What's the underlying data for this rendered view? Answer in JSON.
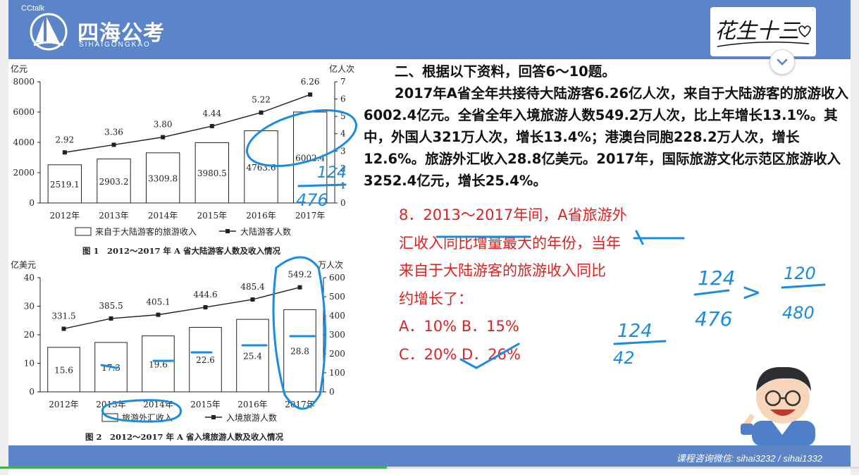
{
  "app": {
    "name": "CCtalk"
  },
  "brand": {
    "title": "四海公考",
    "subtitle": "SIHAIGONGKAO"
  },
  "signature": "花生十三",
  "footer": {
    "contact": "课程咨询微信: sihai3232 / sihai1332"
  },
  "playback": {
    "progress": 0.45
  },
  "colors": {
    "bar": "#5b84c9",
    "question": "#e02020",
    "ink": "#1a8be0"
  },
  "passage": {
    "heading": "二、根据以下资料，回答6～10题。",
    "body": "2017年A省全年共接待大陆游客6.26亿人次，来自于大陆游客的旅游收入6002.4亿元。全省全年入境旅游人数549.2万人次，比上年增长13.1%。其中，外国人321万人次，增长13.4%；港澳台同胞228.2万人次，增长12.6%。旅游外汇收入28.8亿美元。2017年，国际旅游文化示范区旅游收入3252.4亿元，增长25.4%。"
  },
  "question": {
    "line1": "8．2013～2017年间，A省旅游外",
    "line2": "汇收入同比增量最大的年份，当年",
    "line3": "来自于大陆游客的旅游收入同比",
    "line4": "约增长了：",
    "option_a": "A．10%",
    "option_b": "B．15%",
    "option_c": "C．20%",
    "option_d": "D．26%"
  },
  "handwriting": {
    "n124": "124",
    "n476": "476",
    "n120": "120",
    "n480": "480",
    "n42": "42",
    "gt": ">"
  },
  "chart_data": [
    {
      "type": "bar",
      "title": "图 1　2012～2017 年 A 省大陆游客人数及收入情况",
      "categories": [
        "2012年",
        "2013年",
        "2014年",
        "2015年",
        "2016年",
        "2017年"
      ],
      "y_left_unit": "亿元",
      "y_right_unit": "亿人次",
      "y_left_ticks": [
        "0",
        "2000",
        "4000",
        "6000",
        "8000"
      ],
      "y_right_ticks": [
        "0",
        "1",
        "2",
        "3",
        "4",
        "5",
        "6",
        "7"
      ],
      "ylim_left": [
        0,
        8000
      ],
      "ylim_right": [
        0,
        7
      ],
      "bars": {
        "name": "来自于大陆游客的旅游收入",
        "values": [
          2519.1,
          2903.2,
          3309.8,
          3980.5,
          4763.6,
          6002.4
        ],
        "labels": [
          "2519.1",
          "2903.2",
          "3309.8",
          "3980.5",
          "4763.6",
          "6002.4"
        ]
      },
      "line": {
        "name": "大陆游客人数",
        "values": [
          2.92,
          3.36,
          3.8,
          4.44,
          5.22,
          6.26
        ],
        "labels": [
          "2.92",
          "3.36",
          "3.80",
          "4.44",
          "5.22",
          "6.26"
        ]
      }
    },
    {
      "type": "bar",
      "title": "图 2　2012～2017 年 A 省入境旅游人数及收入情况",
      "categories": [
        "2012年",
        "2013年",
        "2014年",
        "2015年",
        "2016年",
        "2017年"
      ],
      "y_left_unit": "亿美元",
      "y_right_unit": "万人次",
      "y_left_ticks": [
        "0",
        "10",
        "20",
        "30",
        "40"
      ],
      "y_right_ticks": [
        "0",
        "100",
        "200",
        "300",
        "400",
        "500",
        "600"
      ],
      "ylim_left": [
        0,
        40
      ],
      "ylim_right": [
        0,
        600
      ],
      "bars": {
        "name": "旅游外汇收入",
        "values": [
          15.6,
          17.3,
          19.6,
          22.6,
          25.4,
          28.8
        ],
        "labels": [
          "15.6",
          "17.3",
          "19.6",
          "22.6",
          "25.4",
          "28.8"
        ]
      },
      "line": {
        "name": "入境旅游人数",
        "values": [
          331.5,
          385.5,
          405.1,
          444.6,
          485.4,
          549.2
        ],
        "labels": [
          "331.5",
          "385.5",
          "405.1",
          "444.6",
          "485.4",
          "549.2"
        ]
      }
    }
  ]
}
